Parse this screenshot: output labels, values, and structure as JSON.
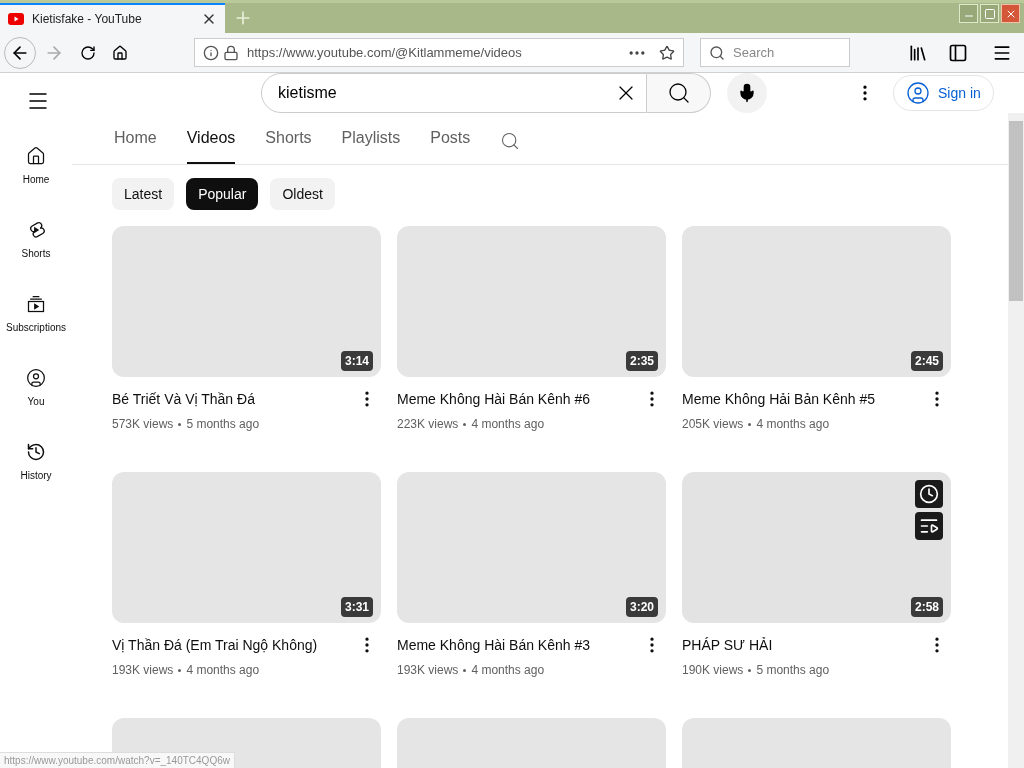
{
  "browser": {
    "tab_title": "Kietisfake - YouTube",
    "url": "https://www.youtube.com/@Kitlammeme/videos",
    "search_placeholder": "Search",
    "status_url": "https://www.youtube.com/watch?v=_140TC4QQ6w"
  },
  "header": {
    "search_value": "kietisme",
    "sign_in": "Sign in"
  },
  "sidebar": {
    "items": [
      {
        "kind": "home",
        "label": "Home"
      },
      {
        "kind": "shorts",
        "label": "Shorts"
      },
      {
        "kind": "subscriptions",
        "label": "Subscriptions"
      },
      {
        "kind": "you",
        "label": "You"
      },
      {
        "kind": "history",
        "label": "History"
      }
    ]
  },
  "channel_tabs": [
    {
      "label": "Home",
      "selected": false
    },
    {
      "label": "Videos",
      "selected": true
    },
    {
      "label": "Shorts",
      "selected": false
    },
    {
      "label": "Playlists",
      "selected": false
    },
    {
      "label": "Posts",
      "selected": false
    }
  ],
  "chips": [
    {
      "label": "Latest",
      "selected": false
    },
    {
      "label": "Popular",
      "selected": true
    },
    {
      "label": "Oldest",
      "selected": false
    }
  ],
  "videos": [
    {
      "duration": "3:14",
      "title": "Bé Triết Và Vị Thần Đá",
      "views": "573K views",
      "age": "5 months ago",
      "hovered": false
    },
    {
      "duration": "2:35",
      "title": "Meme Không Hài Bán Kênh #6",
      "views": "223K views",
      "age": "4 months ago",
      "hovered": false
    },
    {
      "duration": "2:45",
      "title": "Meme Không Hải Bản Kênh #5",
      "views": "205K views",
      "age": "4 months ago",
      "hovered": false
    },
    {
      "duration": "3:31",
      "title": "Vị Thần Đá (Em Trai Ngộ Không)",
      "views": "193K views",
      "age": "4 months ago",
      "hovered": false
    },
    {
      "duration": "3:20",
      "title": "Meme Không Hài Bán Kênh #3",
      "views": "193K views",
      "age": "4 months ago",
      "hovered": false
    },
    {
      "duration": "2:58",
      "title": "PHÁP SƯ HẢI",
      "views": "190K views",
      "age": "5 months ago",
      "hovered": true
    }
  ]
}
